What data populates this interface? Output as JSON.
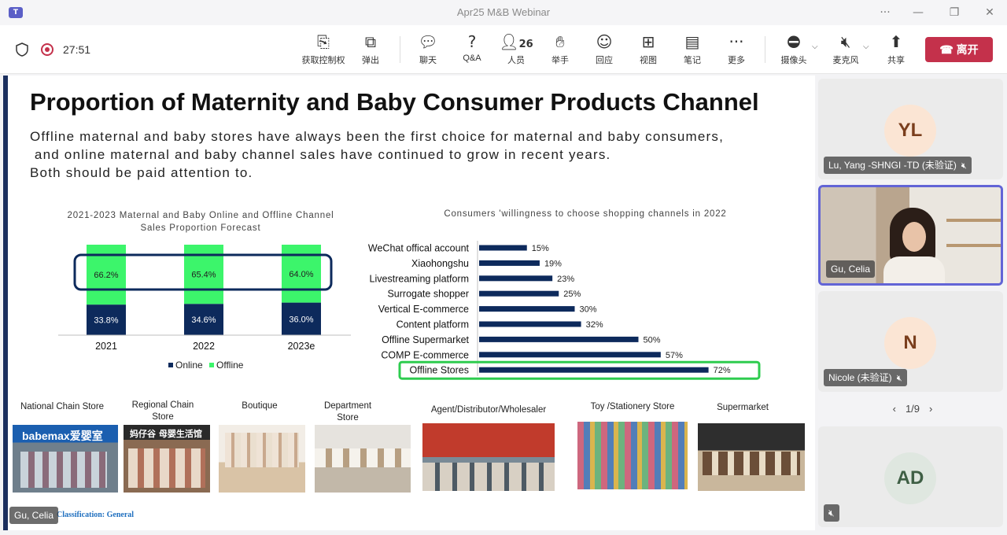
{
  "window": {
    "title": "Apr25 M&B Webinar",
    "app_icon": "teams-icon"
  },
  "toolbar": {
    "timer": "27:51",
    "buttons": [
      {
        "label": "获取控制权",
        "icon": "screen-share-icon"
      },
      {
        "label": "弹出",
        "icon": "pop-out-icon"
      },
      {
        "label": "聊天",
        "icon": "chat-icon"
      },
      {
        "label": "Q&A",
        "icon": "qa-icon"
      },
      {
        "label": "人员",
        "icon": "people-icon",
        "count": "26"
      },
      {
        "label": "举手",
        "icon": "raise-hand-icon"
      },
      {
        "label": "回应",
        "icon": "react-icon"
      },
      {
        "label": "视图",
        "icon": "view-icon"
      },
      {
        "label": "笔记",
        "icon": "notes-icon"
      },
      {
        "label": "更多",
        "icon": "more-icon"
      },
      {
        "label": "摄像头",
        "icon": "camera-off-icon"
      },
      {
        "label": "麦克风",
        "icon": "mic-off-icon"
      },
      {
        "label": "共享",
        "icon": "share-icon"
      }
    ],
    "leave_label": "离开",
    "leave_color": "#c4314b"
  },
  "slide": {
    "title": "Proportion of Maternity and Baby Consumer Products Channel",
    "description": [
      "Offline maternal and baby stores have always been the first choice for maternal and baby consumers,",
      " and online maternal and baby channel sales have continued to grow in recent years.",
      "Both should be paid attention to."
    ],
    "categories": [
      "National Chain Store",
      "Regional Chain Store",
      "Boutique",
      "Department Store",
      "Agent/Distributor/Wholesaler",
      "Toy /Stationery Store",
      "Supermarket"
    ],
    "store_signs": {
      "babemax": "babemax爱婴室",
      "regional": "妈仔谷 母婴生活馆"
    },
    "classification": "Classification: General",
    "presenter_chip": "Gu, Celia"
  },
  "chart_data": [
    {
      "type": "bar",
      "title": "2021-2023 Maternal and Baby Online and Offline Channel Sales Proportion Forecast",
      "categories": [
        "2021",
        "2022",
        "2023e"
      ],
      "series": [
        {
          "name": "Online",
          "values": [
            33.8,
            34.6,
            36.0
          ],
          "labels": [
            "33.8%",
            "34.6%",
            "36.0%"
          ],
          "color": "#0d2a5c"
        },
        {
          "name": "Offline",
          "values": [
            66.2,
            65.4,
            64.0
          ],
          "labels": [
            "66.2%",
            "65.4%",
            "64.0%"
          ],
          "color": "#3cf56b"
        }
      ],
      "stacked": true,
      "legend": "bottom",
      "highlight": "Offline"
    },
    {
      "type": "bar",
      "orientation": "horizontal",
      "title": "Consumers 'willingness to choose shopping channels in 2022",
      "categories": [
        "WeChat offical account",
        "Xiaohongshu",
        "Livestreaming platform",
        "Surrogate shopper",
        "Vertical E-commerce",
        "Content platform",
        "Offline Supermarket",
        "COMP E-commerce",
        "Offline Stores"
      ],
      "values": [
        15,
        19,
        23,
        25,
        30,
        32,
        50,
        57,
        72
      ],
      "labels": [
        "15%",
        "19%",
        "23%",
        "25%",
        "30%",
        "32%",
        "50%",
        "57%",
        "72%"
      ],
      "color": "#0d2a5c",
      "highlight": "Offline Stores",
      "highlight_color": "#2ecc4f"
    }
  ],
  "participants": [
    {
      "initials": "YL",
      "name": "Lu, Yang -SHNGI -TD (未验证)",
      "muted": true
    },
    {
      "initials": "",
      "name": "Gu, Celia",
      "video": true,
      "active": true
    },
    {
      "initials": "N",
      "name": "Nicole (未验证)",
      "muted": true
    },
    {
      "initials": "AD",
      "name": "",
      "muted": true
    }
  ],
  "pager": {
    "text": "1/9"
  },
  "legend": {
    "online": "Online",
    "offline": "Offline"
  }
}
